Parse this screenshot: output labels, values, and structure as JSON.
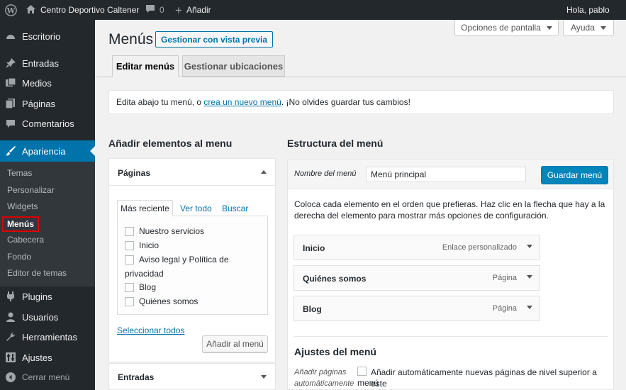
{
  "adminbar": {
    "site_name": "Centro Deportivo Caltener",
    "comments_count": "0",
    "new_label": "Añadir",
    "greeting": "Hola, pablo"
  },
  "sidebar": {
    "items": [
      {
        "label": "Escritorio"
      },
      {
        "label": "Entradas"
      },
      {
        "label": "Medios"
      },
      {
        "label": "Páginas"
      },
      {
        "label": "Comentarios"
      },
      {
        "label": "Apariencia"
      },
      {
        "label": "Plugins"
      },
      {
        "label": "Usuarios"
      },
      {
        "label": "Herramientas"
      },
      {
        "label": "Ajustes"
      },
      {
        "label": "Cerrar menú"
      }
    ],
    "submenu": [
      {
        "label": "Temas"
      },
      {
        "label": "Personalizar"
      },
      {
        "label": "Widgets"
      },
      {
        "label": "Menús"
      },
      {
        "label": "Cabecera"
      },
      {
        "label": "Fondo"
      },
      {
        "label": "Editor de temas"
      }
    ]
  },
  "screen_options": {
    "options_label": "Opciones de pantalla",
    "help_label": "Ayuda"
  },
  "header": {
    "title": "Menús",
    "preview_button": "Gestionar con vista previa"
  },
  "tabs": [
    {
      "label": "Editar menús"
    },
    {
      "label": "Gestionar ubicaciones"
    }
  ],
  "notice": {
    "before": "Edita abajo tu menú, o ",
    "link": "crea un nuevo menú",
    "after": ". ¡No olvides guardar tus cambios!"
  },
  "left": {
    "title": "Añadir elementos al menu",
    "pages_panel": {
      "title": "Páginas",
      "tabs": [
        "Más reciente",
        "Ver todo",
        "Buscar"
      ],
      "items": [
        "Nuestro servicios",
        "Inicio",
        "Aviso legal y Política de",
        "privacidad",
        "Blog",
        "Quiénes somos"
      ],
      "select_all": "Seleccionar todos",
      "add_button": "Añadir al menú"
    },
    "posts_panel": {
      "title": "Entradas"
    }
  },
  "right": {
    "title": "Estructura del menú",
    "menu_name_label": "Nombre del menú",
    "menu_name_value": "Menú principal",
    "save_button": "Guardar menú",
    "instructions_1": "Coloca cada elemento en el orden que prefieras. Haz clic en la flecha que hay a la",
    "instructions_2": "derecha del elemento para mostrar más opciones de configuración.",
    "items": [
      {
        "title": "Inicio",
        "type": "Enlace personalizado"
      },
      {
        "title": "Quiénes somos",
        "type": "Página"
      },
      {
        "title": "Blog",
        "type": "Página"
      }
    ],
    "settings_title": "Ajustes del menú",
    "auto_add_label_1": "Añadir páginas",
    "auto_add_label_2": "automáticamente",
    "auto_add_text_1": "Añadir automáticamente nuevas páginas de nivel superior a este",
    "auto_add_text_2": "menú"
  },
  "colors": {
    "accent": "#0073aa",
    "adminbar": "#23282d",
    "highlight_box": "#dd0000"
  }
}
